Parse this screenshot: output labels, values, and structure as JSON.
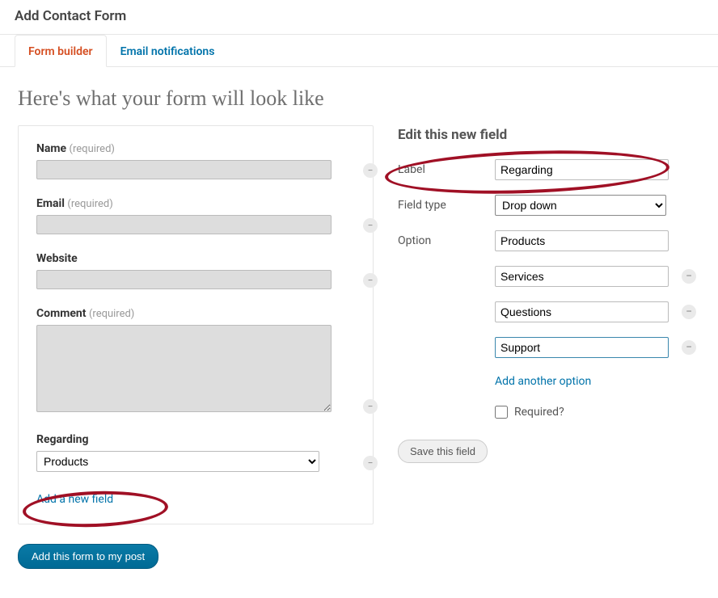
{
  "header": {
    "title": "Add Contact Form"
  },
  "tabs": {
    "active": "Form builder",
    "other": "Email notifications"
  },
  "preview": {
    "title": "Here's what your form will look like",
    "fields": {
      "name": {
        "label": "Name",
        "required": "(required)"
      },
      "email": {
        "label": "Email",
        "required": "(required)"
      },
      "website": {
        "label": "Website"
      },
      "comment": {
        "label": "Comment",
        "required": "(required)"
      },
      "regarding": {
        "label": "Regarding",
        "selected": "Products"
      }
    },
    "add_new_field": "Add a new field"
  },
  "editor": {
    "title": "Edit this new field",
    "labels": {
      "label": "Label",
      "field_type": "Field type",
      "option": "Option"
    },
    "label_value": "Regarding",
    "field_type_value": "Drop down",
    "options": [
      "Products",
      "Services",
      "Questions",
      "Support"
    ],
    "add_option": "Add another option",
    "required_label": "Required?",
    "save_button": "Save this field"
  },
  "submit_button": "Add this form to my post"
}
